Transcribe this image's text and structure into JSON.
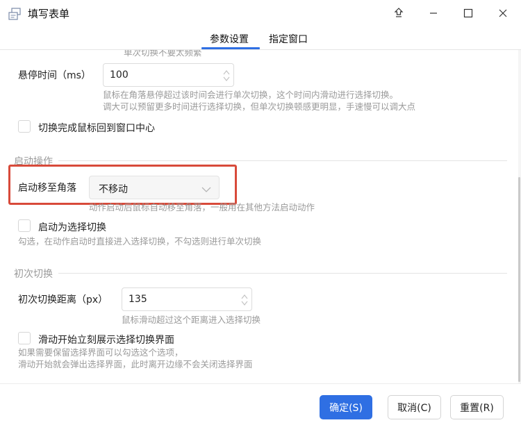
{
  "window": {
    "title": "填写表单",
    "tabs": [
      {
        "label": "参数设置",
        "active": true
      },
      {
        "label": "指定窗口",
        "active": false
      }
    ]
  },
  "settings": {
    "cut_text": "单次切换不要太频繁",
    "hover_time": {
      "label": "悬停时间（ms）",
      "value": "100",
      "hint_lines": [
        "鼠标在角落悬停超过该时间会进行单次切换，这个时间内滑动进行选择切换。",
        "调大可以预留更多时间进行选择切换，但单次切换顿感更明显，手速慢可以调大点"
      ]
    },
    "return_center": {
      "label": "切换完成鼠标回到窗口中心",
      "checked": false
    },
    "startup_section": "启动操作",
    "move_corner": {
      "label": "启动移至角落",
      "value": "不移动",
      "hint": "动作启动后鼠标自动移至角落，一般用在其他方法启动动作"
    },
    "start_select": {
      "label": "启动为选择切换",
      "checked": false,
      "hint": "勾选，在动作启动时直接进入选择切换，不勾选则进行单次切换"
    },
    "first_section": "初次切换",
    "first_distance": {
      "label": "初次切换距离（px）",
      "value": "135",
      "hint": "鼠标滑动超过这个距离进入选择切换"
    },
    "show_ui": {
      "label": "滑动开始立刻展示选择切换界面",
      "checked": false,
      "hint_lines": [
        "如果需要保留选择界面可以勾选这个选项，",
        "滑动开始就会弹出选择界面，此时离开边缘不会关闭选择界面"
      ]
    }
  },
  "footer": {
    "ok": "确定(S)",
    "cancel": "取消(C)",
    "reset": "重置(R)"
  },
  "colors": {
    "accent": "#2f6fe3",
    "highlight": "#d84a3a"
  }
}
